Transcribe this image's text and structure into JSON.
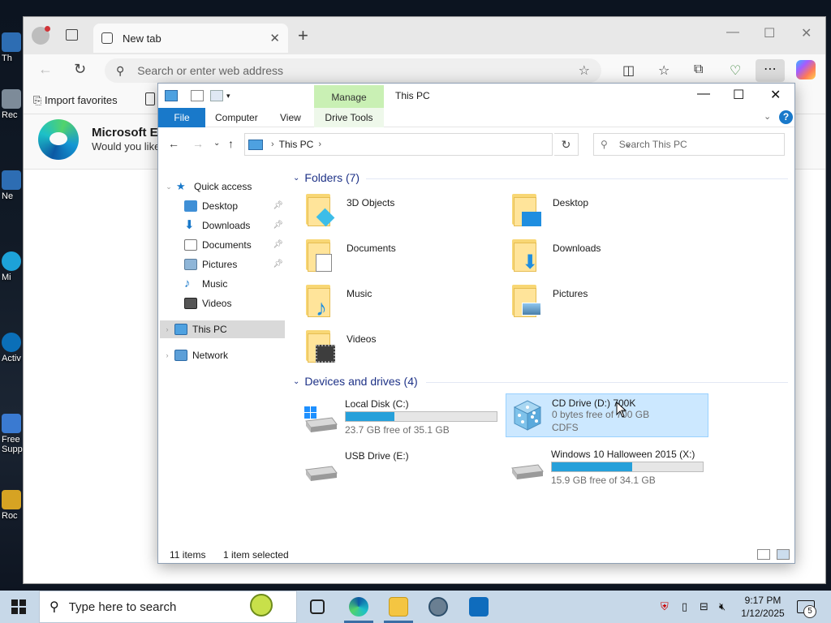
{
  "desktop": {
    "icons": [
      {
        "label": "Th"
      },
      {
        "label": "Rec"
      },
      {
        "label": "Ne"
      },
      {
        "label": "Mi"
      },
      {
        "label": "Activ"
      },
      {
        "label": "Free Supp"
      },
      {
        "label": "Roc"
      }
    ]
  },
  "browser": {
    "tab": {
      "label": "New tab"
    },
    "address_placeholder": "Search or enter web address",
    "favorites": {
      "import_label": "Import favorites"
    },
    "promo": {
      "title": "Microsoft Ed",
      "subtitle": "Would you like"
    }
  },
  "explorer": {
    "title": "This PC",
    "contextual_tab": "Manage",
    "ribbon_tabs": [
      "File",
      "Computer",
      "View",
      "Drive Tools"
    ],
    "breadcrumb": "This PC",
    "search_placeholder": "Search This PC",
    "nav": {
      "quick_access": "Quick access",
      "items": [
        {
          "label": "Desktop",
          "pinned": true
        },
        {
          "label": "Downloads",
          "pinned": true
        },
        {
          "label": "Documents",
          "pinned": true
        },
        {
          "label": "Pictures",
          "pinned": true
        },
        {
          "label": "Music",
          "pinned": false
        },
        {
          "label": "Videos",
          "pinned": false
        }
      ],
      "this_pc": "This PC",
      "network": "Network"
    },
    "folders_header": "Folders (7)",
    "folders": [
      {
        "label": "3D Objects",
        "icon": "3d-objects-icon"
      },
      {
        "label": "Desktop",
        "icon": "desktop-icon"
      },
      {
        "label": "Documents",
        "icon": "documents-icon"
      },
      {
        "label": "Downloads",
        "icon": "downloads-icon"
      },
      {
        "label": "Music",
        "icon": "music-icon"
      },
      {
        "label": "Pictures",
        "icon": "pictures-icon"
      },
      {
        "label": "Videos",
        "icon": "videos-icon"
      }
    ],
    "drives_header": "Devices and drives (4)",
    "drives": [
      {
        "label": "Local Disk (C:)",
        "free": "23.7 GB free of 35.1 GB",
        "used_fraction": 0.325,
        "fs": ""
      },
      {
        "label": "CD Drive (D:) 700K",
        "free": "0 bytes free of 700 GB",
        "fs": "CDFS",
        "selected": true
      },
      {
        "label": "USB Drive (E:)",
        "free": "",
        "fs": ""
      },
      {
        "label": "Windows 10 Halloween 2015 (X:)",
        "free": "15.9 GB free of 34.1 GB",
        "used_fraction": 0.534,
        "fs": ""
      }
    ],
    "status": {
      "items": "11 items",
      "selected": "1 item selected"
    }
  },
  "taskbar": {
    "search_placeholder": "Type here to search",
    "time": "9:17 PM",
    "date": "1/12/2025",
    "notifications": "5"
  },
  "colors": {
    "accent": "#1979ca",
    "drive_bar": "#26a0da",
    "selection": "#cce8ff",
    "manage_tab": "#c9f0b4"
  }
}
